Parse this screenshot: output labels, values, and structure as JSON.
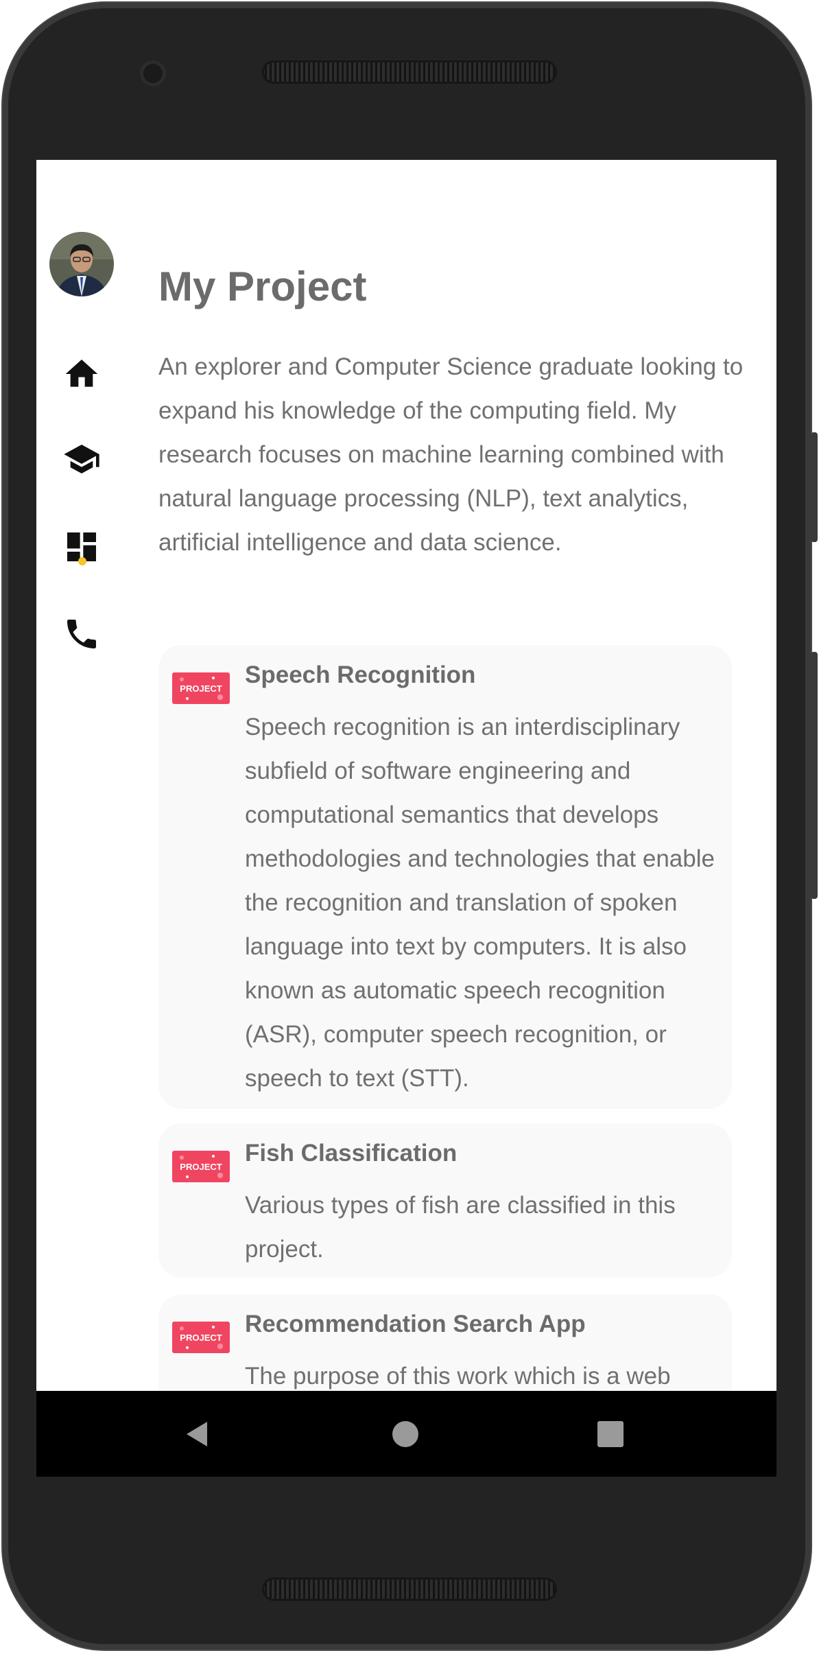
{
  "page": {
    "title": "My Project",
    "intro": "An explorer and Computer Science graduate looking to expand his knowledge of the computing field. My research focuses on machine learning combined with natural language processing (NLP), text analytics, artificial intelligence and data science."
  },
  "nav": {
    "items": [
      {
        "icon": "home-icon"
      },
      {
        "icon": "graduation-cap-icon"
      },
      {
        "icon": "dashboard-icon",
        "active": true
      },
      {
        "icon": "phone-icon"
      }
    ],
    "active_indicator_color": "#f7c325"
  },
  "projects": [
    {
      "thumb_label": "PROJECT",
      "title": "Speech Recognition",
      "description": "Speech recognition is an interdisciplinary subfield of software engineering and computational semantics that develops methodologies and technologies that enable the recognition and translation of spoken language into text by computers. It is also known as automatic speech recognition (ASR), computer speech recognition, or speech to text (STT)."
    },
    {
      "thumb_label": "PROJECT",
      "title": "Fish Classification",
      "description": "Various types of fish are classified in this project."
    },
    {
      "thumb_label": "PROJECT",
      "title": "Recommendation Search App",
      "description": "The purpose of this work which is a web"
    }
  ],
  "colors": {
    "text": "#707070",
    "heading": "#6b6b6b",
    "card_bg": "#f9f9f9",
    "thumb": "#f04560"
  },
  "system_nav": {
    "back": "back-icon",
    "home": "home-circle-icon",
    "recents": "recents-icon"
  }
}
